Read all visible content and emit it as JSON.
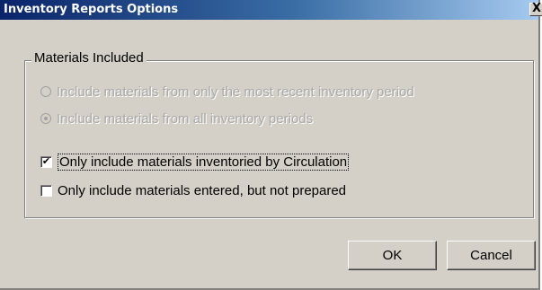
{
  "window": {
    "title": "Inventory Reports Options",
    "close_label": "X"
  },
  "group": {
    "legend": "Materials Included",
    "options": [
      {
        "type": "radio",
        "label": "Include materials from only the most recent inventory period",
        "checked": false,
        "enabled": false
      },
      {
        "type": "radio",
        "label": "Include materials from all inventory periods",
        "checked": true,
        "enabled": false
      },
      {
        "type": "checkbox",
        "label": "Only include materials inventoried by Circulation",
        "checked": true,
        "enabled": true,
        "focused": true
      },
      {
        "type": "checkbox",
        "label": "Only include materials entered, but not prepared",
        "checked": false,
        "enabled": true
      }
    ]
  },
  "buttons": {
    "ok_label": "OK",
    "cancel_label": "Cancel"
  },
  "check_mark": "✔"
}
